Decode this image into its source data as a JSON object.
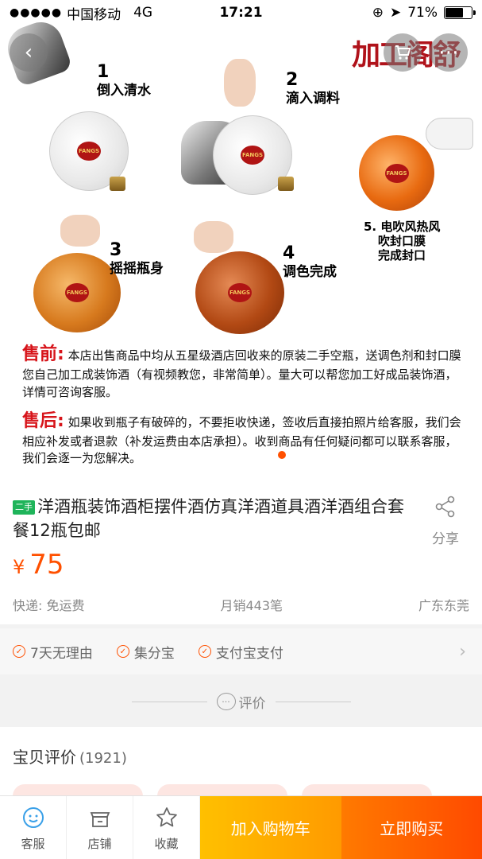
{
  "status_bar": {
    "carrier": "中国移动",
    "network": "4G",
    "time": "17:21",
    "battery": "71%",
    "battery_level": 0.71
  },
  "hero": {
    "brand_mark": "加工阁舒",
    "steps": [
      {
        "num": "1",
        "label": "倒入清水"
      },
      {
        "num": "2",
        "label": "滴入调料"
      },
      {
        "num": "3",
        "label": "摇摇瓶身"
      },
      {
        "num": "4",
        "label": "调色完成"
      }
    ],
    "step5": [
      "5. 电吹风热风",
      "吹封口膜",
      "完成封口"
    ],
    "bottle_label": "FANGS",
    "notice": {
      "before_tag": "售前:",
      "before_text": "本店出售商品中均从五星级酒店回收来的原装二手空瓶，送调色剂和封口膜您自己加工成装饰酒（有视频教您，非常简单）。量大可以帮您加工好成品装饰酒，详情可咨询客服。",
      "after_tag": "售后:",
      "after_text": "如果收到瓶子有破碎的，不要拒收快递，签收后直接拍照片给客服，我们会相应补发或者退款（补发运费由本店承担）。收到商品有任何疑问都可以联系客服，我们会逐一为您解决。"
    }
  },
  "product": {
    "badge": "二手",
    "title": "洋酒瓶装饰酒柜摆件酒仿真洋酒道具酒洋酒组合套餐12瓶包邮",
    "share_label": "分享",
    "currency": "¥",
    "price": "75",
    "shipping": "快递: 免运费",
    "monthly_sales": "月销443笔",
    "location": "广东东莞"
  },
  "services": [
    "7天无理由",
    "集分宝",
    "支付宝支付"
  ],
  "divider_label": "评价",
  "reviews": {
    "title": "宝贝评价",
    "count": "(1921)"
  },
  "bottom_bar": {
    "service": "客服",
    "shop": "店铺",
    "favorite": "收藏",
    "add_cart": "加入购物车",
    "buy_now": "立即购买"
  },
  "colors": {
    "accent": "#ff5000",
    "cart": "#ff9a00",
    "buy": "#ff4a00",
    "notice_red": "#d7141a"
  }
}
